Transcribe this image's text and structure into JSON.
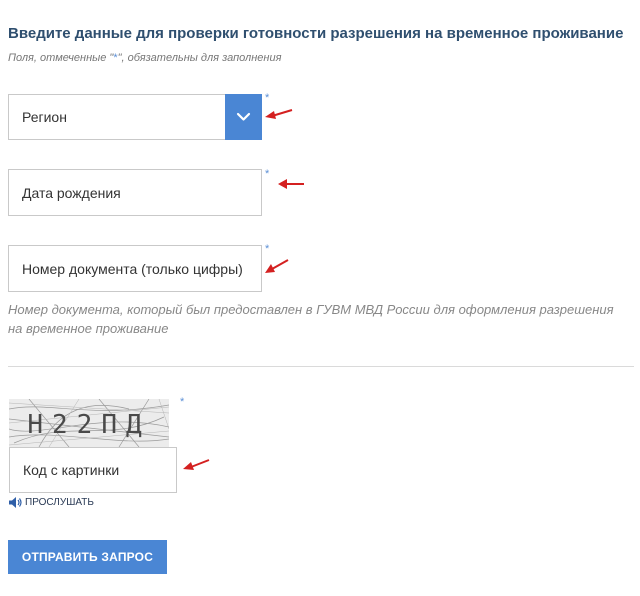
{
  "form": {
    "title": "Введите данные для проверки готовности разрешения на временное проживание",
    "required_note_prefix": "Поля, отмеченные \"",
    "required_note_star": "*",
    "required_note_suffix": "\", обязательны для заполнения",
    "required_marker": "*",
    "region": {
      "label": "Регион"
    },
    "birth_date": {
      "placeholder": "Дата рождения"
    },
    "document_number": {
      "placeholder": "Номер документа (только цифры)"
    },
    "document_hint": "Номер документа, который был предоставлен в ГУВМ МВД России для оформления разрешения на временное проживание",
    "captcha": {
      "image_text": "Н22ПД",
      "placeholder": "Код с картинки",
      "listen_label": "ПРОСЛУШАТЬ"
    },
    "submit_label": "ОТПРАВИТЬ ЗАПРОС"
  },
  "colors": {
    "accent": "#4a86d4",
    "title": "#2f4f6f",
    "arrow": "#d42020"
  }
}
